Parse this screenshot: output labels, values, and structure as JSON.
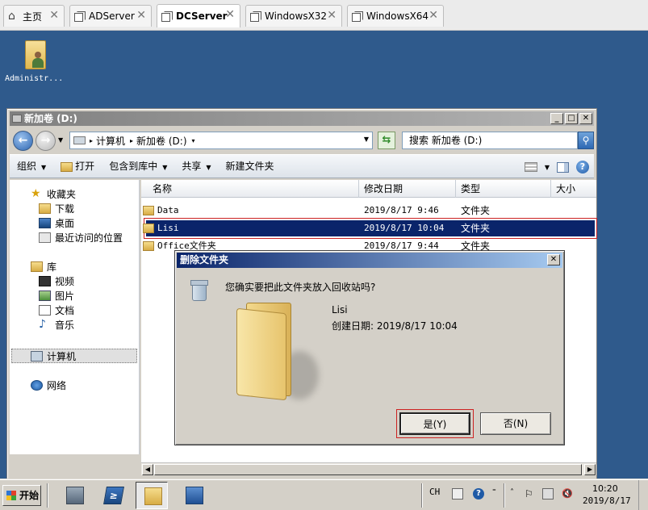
{
  "host_tabs": [
    {
      "label": "主页"
    },
    {
      "label": "ADServer"
    },
    {
      "label": "DCServer"
    },
    {
      "label": "WindowsX32"
    },
    {
      "label": "WindowsX64"
    }
  ],
  "desktop": {
    "icon_label": "Administr..."
  },
  "explorer": {
    "title": "新加卷 (D:)",
    "address_crumbs": [
      "计算机",
      "新加卷 (D:)"
    ],
    "search_placeholder": "搜索 新加卷 (D:)",
    "toolbar": {
      "organize": "组织",
      "open": "打开",
      "include_in_library": "包含到库中",
      "share": "共享",
      "new_folder": "新建文件夹"
    },
    "nav": {
      "favorites": "收藏夹",
      "downloads": "下载",
      "desktop": "桌面",
      "recent": "最近访问的位置",
      "libraries": "库",
      "videos": "视频",
      "pictures": "图片",
      "documents": "文档",
      "music": "音乐",
      "computer": "计算机",
      "network": "网络"
    },
    "columns": {
      "name": "名称",
      "modified": "修改日期",
      "type": "类型",
      "size": "大小"
    },
    "files": [
      {
        "name": "Data",
        "modified": "2019/8/17 9:46",
        "type": "文件夹"
      },
      {
        "name": "Lisi",
        "modified": "2019/8/17 10:04",
        "type": "文件夹"
      },
      {
        "name": "Office文件夹",
        "modified": "2019/8/17 9:44",
        "type": "文件夹"
      }
    ]
  },
  "dialog": {
    "title": "删除文件夹",
    "message": "您确实要把此文件夹放入回收站吗?",
    "item_name": "Lisi",
    "item_created": "创建日期: 2019/8/17 10:04",
    "yes": "是(Y)",
    "no": "否(N)"
  },
  "taskbar": {
    "start": "开始",
    "lang": "CH",
    "time": "10:20",
    "date": "2019/8/17"
  }
}
